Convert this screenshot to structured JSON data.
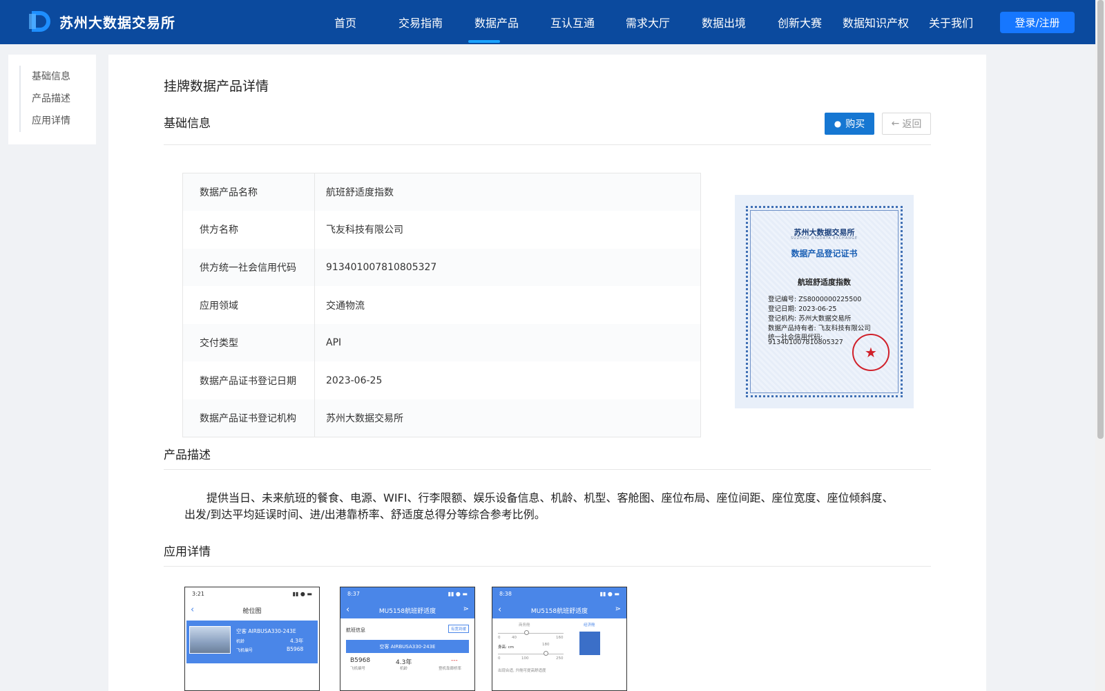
{
  "header": {
    "logo_text": "苏州大数据交易所",
    "nav": [
      "首页",
      "交易指南",
      "数据产品",
      "互认互通",
      "需求大厅",
      "数据出境",
      "创新大赛",
      "数据知识产权",
      "关于我们"
    ],
    "active_nav": "数据产品",
    "login_label": "登录/注册",
    "colors": {
      "bg": "#0b4a9e",
      "accent": "#1677ff"
    }
  },
  "sidebar": {
    "items": [
      "基础信息",
      "产品描述",
      "应用详情"
    ]
  },
  "main": {
    "page_title": "挂牌数据产品详情",
    "basic_section_title": "基础信息",
    "buy_label": "购买",
    "back_label": "返回",
    "info_rows": [
      {
        "key": "数据产品名称",
        "value": "航班舒适度指数"
      },
      {
        "key": "供方名称",
        "value": "飞友科技有限公司"
      },
      {
        "key": "供方统一社会信用代码",
        "value": "913401007810805327"
      },
      {
        "key": "应用领域",
        "value": "交通物流"
      },
      {
        "key": "交付类型",
        "value": "API"
      },
      {
        "key": "数据产品证书登记日期",
        "value": "2023-06-25"
      },
      {
        "key": "数据产品证书登记机构",
        "value": "苏州大数据交易所"
      }
    ],
    "certificate": {
      "org": "苏州大数据交易所",
      "org_sub": "SUZHOU BIGDATA EXCHANGE",
      "title": "数据产品登记证书",
      "product": "航班舒适度指数",
      "lines": [
        "登记编号: ZS8000000225500",
        "登记日期: 2023-06-25",
        "登记机构: 苏州大数据交易所",
        "数据产品持有者: 飞友科技有限公司",
        "统一社会信用代码:",
        "913401007810805327"
      ]
    },
    "desc_section_title": "产品描述",
    "description": "提供当日、未来航班的餐食、电源、WIFI、行李限额、娱乐设备信息、机龄、机型、客舱图、座位布局、座位间距、座位宽度、座位倾斜度、出发/到达平均延误时间、进/出港靠桥率、舒适度总得分等综合参考比例。",
    "app_section_title": "应用详情",
    "phones": [
      {
        "time": "3:21",
        "title": "舱位图",
        "aircraft": "空客 AIRBUSA330-243E",
        "age_label": "机龄",
        "age": "4.3年",
        "reg_label": "飞机编号",
        "reg": "B5968"
      },
      {
        "time": "8:37",
        "title": "MU5158航班舒适度",
        "info_label": "航班信息",
        "tag": "有宽到缓",
        "aircraft": "空客 AIRBUSA330-243E",
        "reg": "B5968",
        "reg_label": "飞机编号",
        "age": "4.3年",
        "age_label": "机龄",
        "bridge": "---",
        "bridge_label": "登机靠廊桥率"
      },
      {
        "time": "8:38",
        "title": "MU5158航班舒适度",
        "tab_business": "商务舱",
        "tab_economy": "经济舱",
        "height_label": "身高: cm",
        "scale1": [
          "0",
          "40",
          "160"
        ],
        "scale2": [
          "0",
          "100",
          "250"
        ],
        "mark": "180",
        "note": "出现合适, 升舱可提高舒适度"
      }
    ]
  }
}
